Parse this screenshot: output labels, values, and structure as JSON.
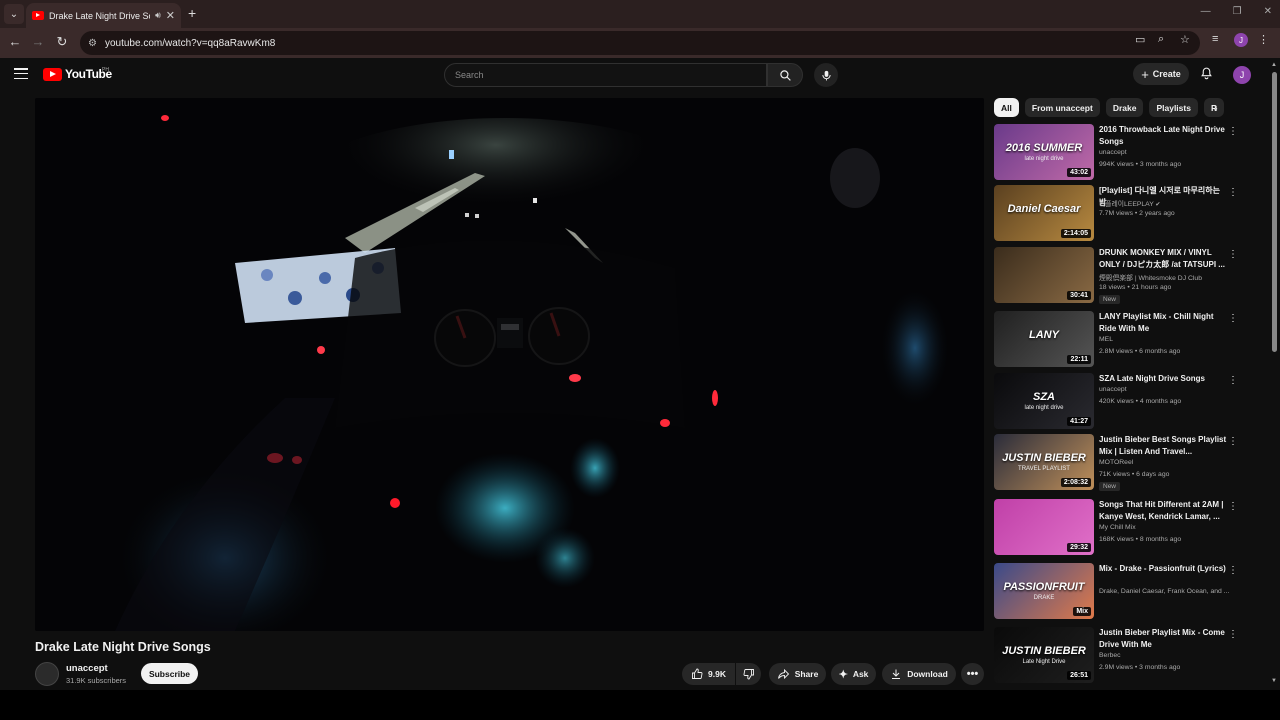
{
  "browser": {
    "tab_title": "Drake Late Night Drive Songs",
    "url": "youtube.com/watch?v=qq8aRavwKm8",
    "profile_initial": "J"
  },
  "masthead": {
    "logo_text": "YouTube",
    "country_code": "PH",
    "search_placeholder": "Search",
    "create_label": "Create",
    "avatar_initial": "J"
  },
  "video": {
    "title": "Drake Late Night Drive Songs",
    "channel": "unaccept",
    "subscribers": "31.9K subscribers",
    "subscribe_label": "Subscribe",
    "likes": "9.9K",
    "share_label": "Share",
    "ask_label": "Ask",
    "download_label": "Download"
  },
  "chips": [
    "All",
    "From unaccept",
    "Drake",
    "Playlists",
    "R"
  ],
  "recommendations": [
    {
      "title": "2016 Throwback Late Night Drive Songs",
      "channel": "unaccept",
      "meta": "994K views • 3 months ago",
      "duration": "43:02",
      "thumb_text": "2016 SUMMER",
      "thumb_sub": "late night drive",
      "bg": "#6a3a8a",
      "bg2": "#c06aa8",
      "badge": ""
    },
    {
      "title": "[Playlist] 다니엘 시저로 마무리하는 밤",
      "channel": "리플레이LEEPLAY",
      "meta": "7.7M views • 2 years ago",
      "duration": "2:14:05",
      "thumb_text": "Daniel Caesar",
      "thumb_sub": "",
      "bg": "#5a4020",
      "bg2": "#b88a40",
      "badge": "",
      "verified": true
    },
    {
      "title": "DRUNK MONKEY MIX / VINYL ONLY / DJピカ太郎 /at TATSUPI ...",
      "channel": "煙殿倶楽部 | Whitesmoke DJ Club",
      "meta": "18 views • 21 hours ago",
      "duration": "30:41",
      "thumb_text": "",
      "thumb_sub": "",
      "bg": "#3a2c1c",
      "bg2": "#8a6a44",
      "badge": "New"
    },
    {
      "title": "LANY Playlist Mix - Chill Night Ride With Me",
      "channel": "MEL",
      "meta": "2.8M views • 6 months ago",
      "duration": "22:11",
      "thumb_text": "LANY",
      "thumb_sub": "",
      "bg": "#202020",
      "bg2": "#555555",
      "badge": ""
    },
    {
      "title": "SZA Late Night Drive Songs",
      "channel": "unaccept",
      "meta": "420K views • 4 months ago",
      "duration": "41:27",
      "thumb_text": "SZA",
      "thumb_sub": "late night drive",
      "bg": "#0a0a0c",
      "bg2": "#2a2a30",
      "badge": ""
    },
    {
      "title": "Justin Bieber Best Songs Playlist Mix | Listen And Travel...",
      "channel": "MOTOReel",
      "meta": "71K views • 6 days ago",
      "duration": "2:08:32",
      "thumb_text": "JUSTIN BIEBER",
      "thumb_sub": "TRAVEL PLAYLIST",
      "bg": "#2a2c3a",
      "bg2": "#c0905a",
      "badge": "New"
    },
    {
      "title": "Songs That Hit Different at 2AM | Kanye West, Kendrick Lamar, ...",
      "channel": "My Chill Mix",
      "meta": "168K views • 8 months ago",
      "duration": "29:32",
      "thumb_text": "",
      "thumb_sub": "",
      "bg": "#c040a8",
      "bg2": "#e070c8",
      "badge": ""
    },
    {
      "title": "Mix - Drake - Passionfruit (Lyrics)",
      "channel": "Drake, Daniel Caesar, Frank Ocean, and ...",
      "meta": "",
      "duration": "Mix",
      "thumb_text": "PASSIONFRUIT",
      "thumb_sub": "DRAKE",
      "bg": "#3a4a8a",
      "bg2": "#e07a4a",
      "badge": ""
    },
    {
      "title": "Justin Bieber Playlist Mix - Come Drive With Me",
      "channel": "Berbec",
      "meta": "2.9M views • 3 months ago",
      "duration": "26:51",
      "thumb_text": "JUSTIN BIEBER",
      "thumb_sub": "Late Night Drive",
      "bg": "#0a0a0a",
      "bg2": "#1e1e1e",
      "badge": ""
    }
  ]
}
